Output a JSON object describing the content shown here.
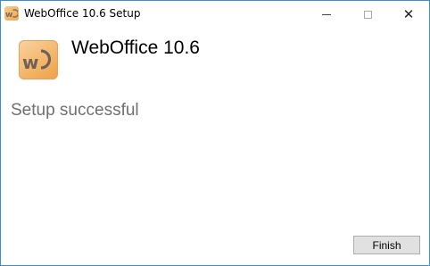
{
  "window": {
    "title": "WebOffice 10.6 Setup",
    "controls": {
      "minimize": "minimize",
      "maximize": "maximize",
      "close": "close"
    }
  },
  "header": {
    "app_name": "WebOffice 10.6",
    "logo_icon": "weboffice-logo-icon",
    "logo_color": "#f3b466"
  },
  "main": {
    "status_text": "Setup successful"
  },
  "footer": {
    "finish_label": "Finish"
  },
  "icons": {
    "close": "✕"
  }
}
